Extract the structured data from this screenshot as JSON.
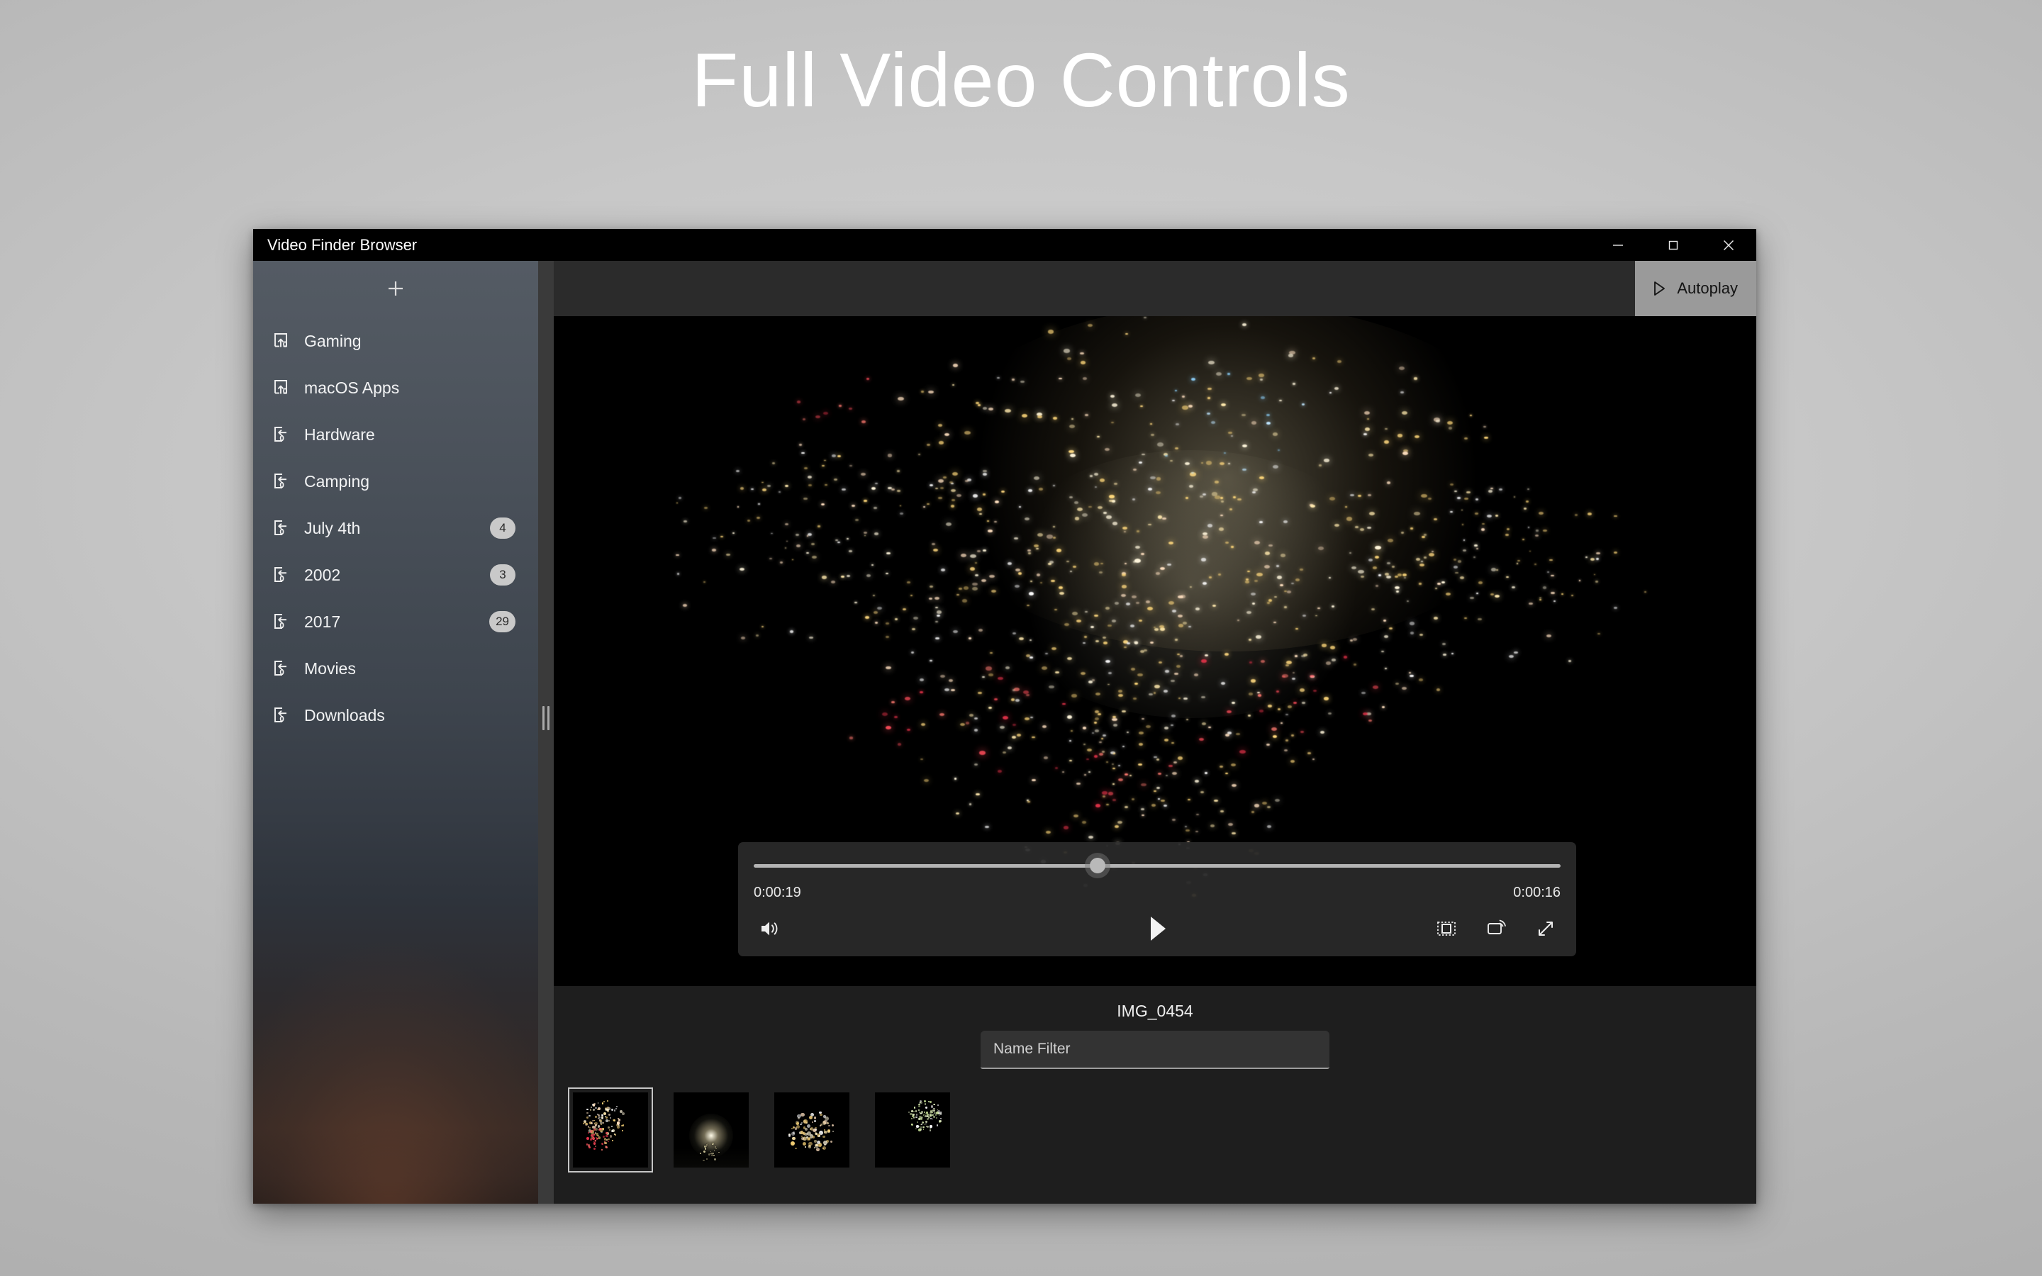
{
  "hero": {
    "title": "Full Video Controls"
  },
  "window": {
    "title": "Video Finder Browser",
    "controls": {
      "minimize": "minimize",
      "maximize": "maximize",
      "close": "close"
    }
  },
  "sidebar": {
    "add_label": "+",
    "items": [
      {
        "label": "Gaming",
        "icon": "export-folder-icon",
        "badge": ""
      },
      {
        "label": "macOS Apps",
        "icon": "export-folder-icon",
        "badge": ""
      },
      {
        "label": "Hardware",
        "icon": "import-folder-icon",
        "badge": ""
      },
      {
        "label": "Camping",
        "icon": "import-folder-icon",
        "badge": ""
      },
      {
        "label": "July 4th",
        "icon": "import-folder-icon",
        "badge": "4"
      },
      {
        "label": "2002",
        "icon": "import-folder-icon",
        "badge": "3"
      },
      {
        "label": "2017",
        "icon": "import-folder-icon",
        "badge": "29"
      },
      {
        "label": "Movies",
        "icon": "import-folder-icon",
        "badge": ""
      },
      {
        "label": "Downloads",
        "icon": "import-folder-icon",
        "badge": ""
      }
    ]
  },
  "toolbar": {
    "autoplay_label": "Autoplay",
    "autoplay_icon": "play-triangle-icon"
  },
  "player": {
    "current_time": "0:00:19",
    "remaining_time": "0:00:16",
    "progress_percent": 42.6,
    "state": "paused",
    "buttons": {
      "volume": "volume-icon",
      "play": "play-icon",
      "miniplayer": "mini-player-icon",
      "cast": "cast-icon",
      "fullscreen": "fullscreen-icon"
    }
  },
  "media": {
    "name": "IMG_0454"
  },
  "filter": {
    "placeholder": "Name Filter",
    "value": ""
  },
  "thumbnails": [
    {
      "name": "thumb-1",
      "selected": true
    },
    {
      "name": "thumb-2",
      "selected": false
    },
    {
      "name": "thumb-3",
      "selected": false
    },
    {
      "name": "thumb-4",
      "selected": false
    }
  ],
  "colors": {
    "window_chrome": "#000000",
    "sidebar_top": "#545b64",
    "sidebar_bottom": "#241d1b",
    "panel_bg": "#1e1e1e",
    "toolbar_bg": "#2b2b2b",
    "accent_button": "#9a9a9a",
    "badge_bg": "#c9c9c9",
    "seek_track": "#b4b4b4"
  }
}
